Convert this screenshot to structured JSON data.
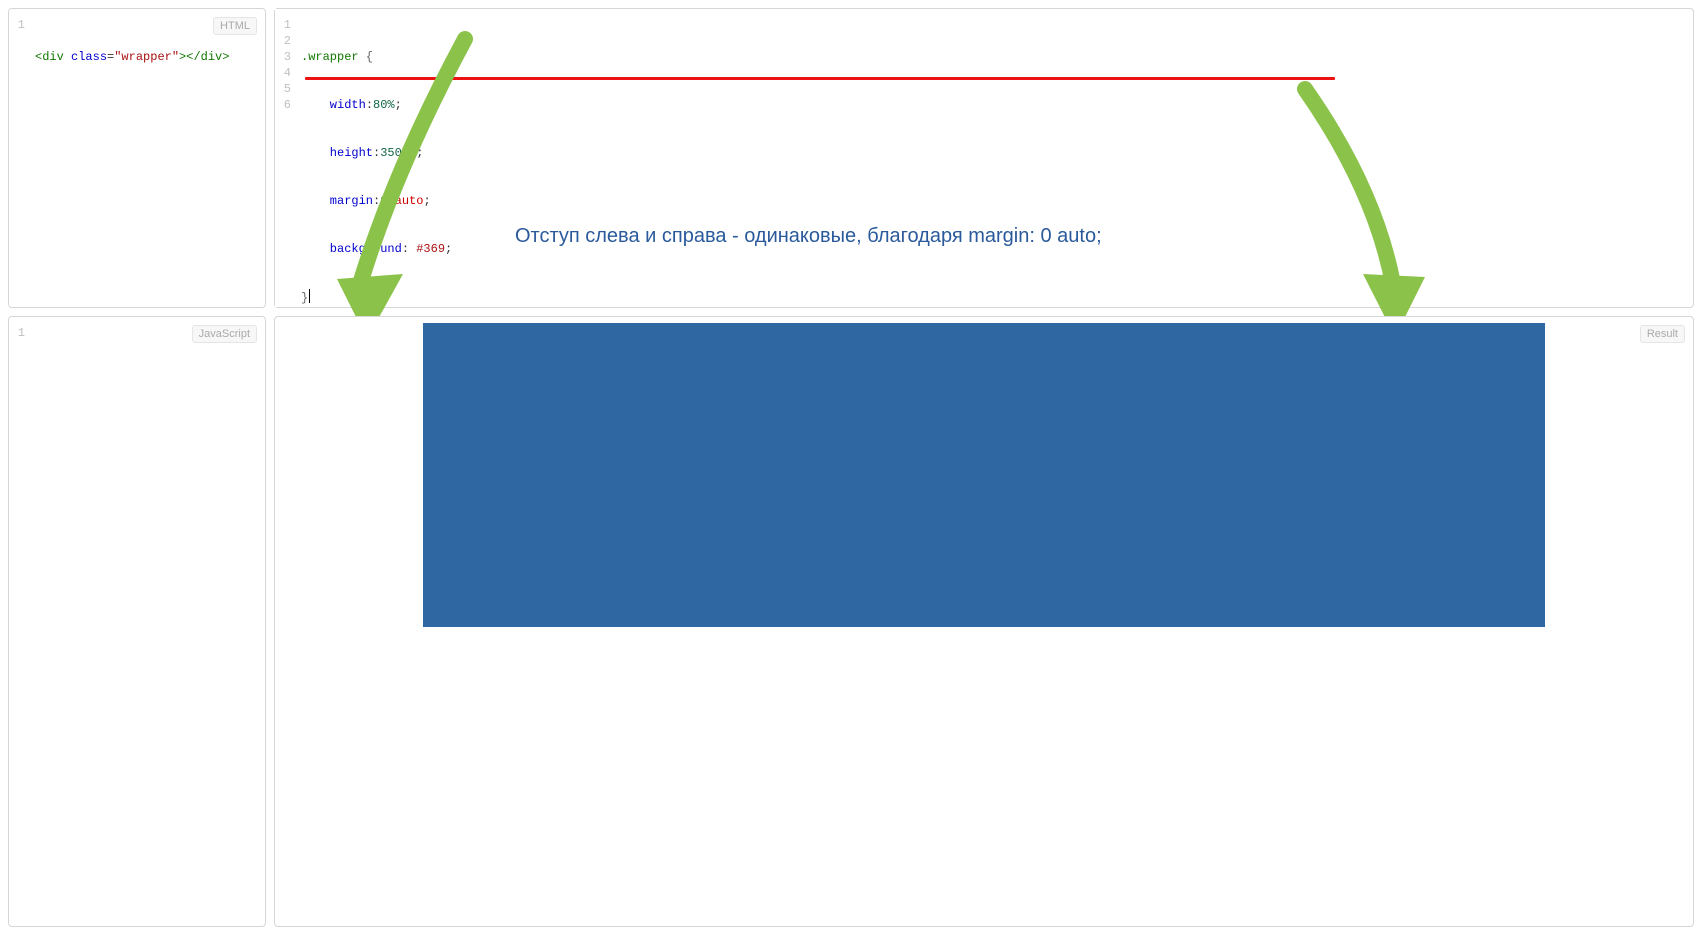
{
  "labels": {
    "html": "HTML",
    "css": "",
    "js": "JavaScript",
    "result": "Result"
  },
  "htmlPanel": {
    "lines": [
      "1"
    ],
    "code": {
      "l1_a": "<div",
      "l1_b": " class",
      "l1_c": "=",
      "l1_d": "\"wrapper\"",
      "l1_e": "></div>"
    }
  },
  "cssPanel": {
    "lines": [
      "1",
      "2",
      "3",
      "4",
      "5",
      "6"
    ],
    "code": {
      "l1_sel": ".wrapper",
      "l1_brace": " {",
      "l2_prop": "    width",
      "l2_colon": ":",
      "l2_val": "80%",
      "l2_semi": ";",
      "l3_prop": "    height",
      "l3_colon": ":",
      "l3_val": "350px",
      "l3_semi": ";",
      "l4_prop": "    margin",
      "l4_colon": ":",
      "l4_val_a": "0",
      "l4_sp": " ",
      "l4_val_b": "auto",
      "l4_semi": ";",
      "l5_prop": "    background",
      "l5_colon": ": ",
      "l5_val": "#369",
      "l5_semi": ";",
      "l6_brace": "}"
    },
    "annotation": "Отступ слева и справа - одинаковые, благодаря margin: 0 auto;"
  },
  "jsPanel": {
    "lines": [
      "1"
    ]
  }
}
